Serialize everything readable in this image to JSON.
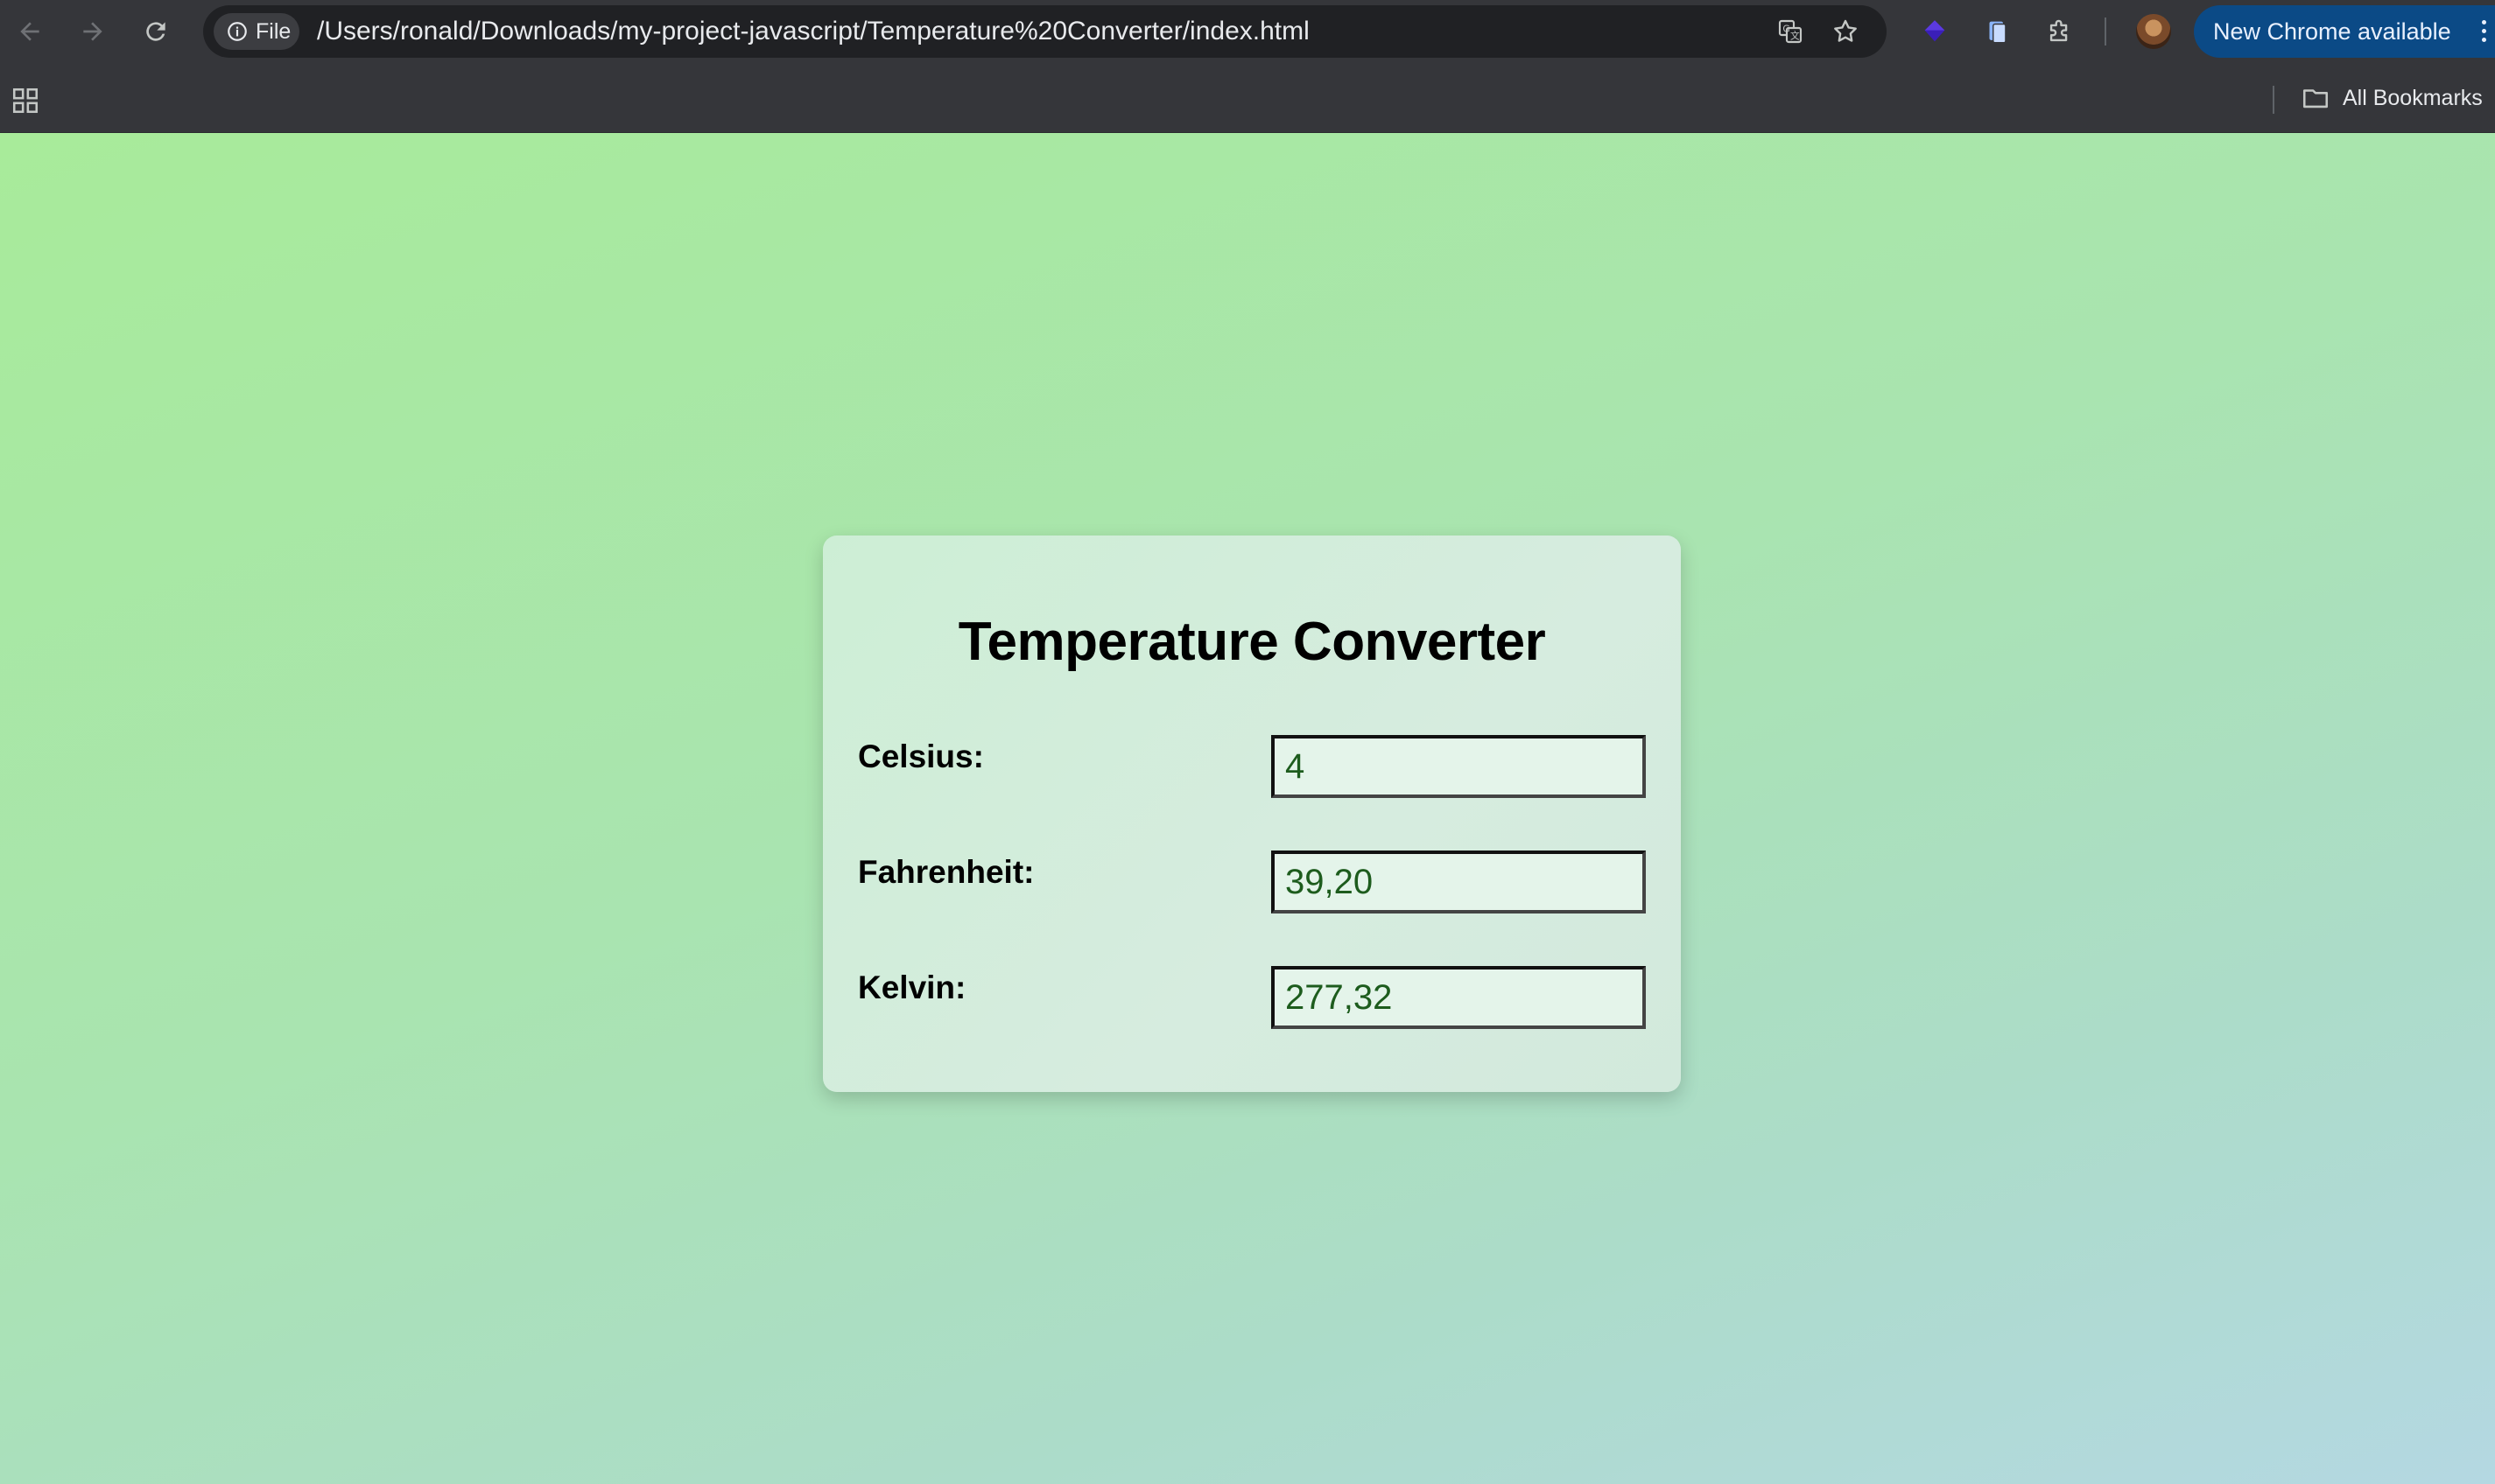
{
  "browser": {
    "chip_label": "File",
    "url": "/Users/ronald/Downloads/my-project-javascript/Temperature%20Converter/index.html",
    "update_button_label": "New Chrome available",
    "bookmarks_label": "All Bookmarks",
    "icons": {
      "back": "back-arrow-icon",
      "forward": "forward-arrow-icon",
      "reload": "reload-icon",
      "info": "info-icon",
      "translate": "translate-icon",
      "bookmark": "star-icon",
      "extension_1": "purple-gem-icon",
      "extension_2": "document-icon",
      "extensions": "puzzle-icon",
      "apps": "apps-grid-icon",
      "folder": "folder-icon"
    }
  },
  "page": {
    "title": "Temperature Converter",
    "fields": [
      {
        "label": "Celsius:",
        "value": "4"
      },
      {
        "label": "Fahrenheit:",
        "value": "39,20"
      },
      {
        "label": "Kelvin:",
        "value": "277,32"
      }
    ]
  },
  "colors": {
    "background_start": "#a8eb9a",
    "background_end": "#b4d8e2",
    "value_text": "#1d5c1d",
    "update_button": "#0b4a86"
  }
}
